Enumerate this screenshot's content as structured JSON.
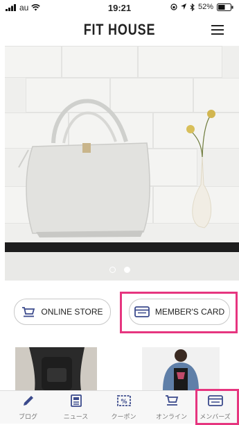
{
  "status_bar": {
    "carrier": "au",
    "time": "19:21",
    "battery": "52%"
  },
  "header": {
    "brand": "FIT HOUSE"
  },
  "hero": {
    "slides": 2,
    "active_slide": 2
  },
  "quick_links": {
    "online_store": "ONLINE STORE",
    "members_card": "MEMBER'S CARD"
  },
  "tabs": [
    {
      "label": "ブログ",
      "icon": "pencil-icon"
    },
    {
      "label": "ニュース",
      "icon": "news-icon"
    },
    {
      "label": "クーポン",
      "icon": "coupon-icon"
    },
    {
      "label": "オンライン",
      "icon": "cart-icon"
    },
    {
      "label": "メンバーズ",
      "icon": "member-card-icon"
    }
  ],
  "colors": {
    "highlight": "#e6357f",
    "tab_icon": "#3b4a8c"
  }
}
